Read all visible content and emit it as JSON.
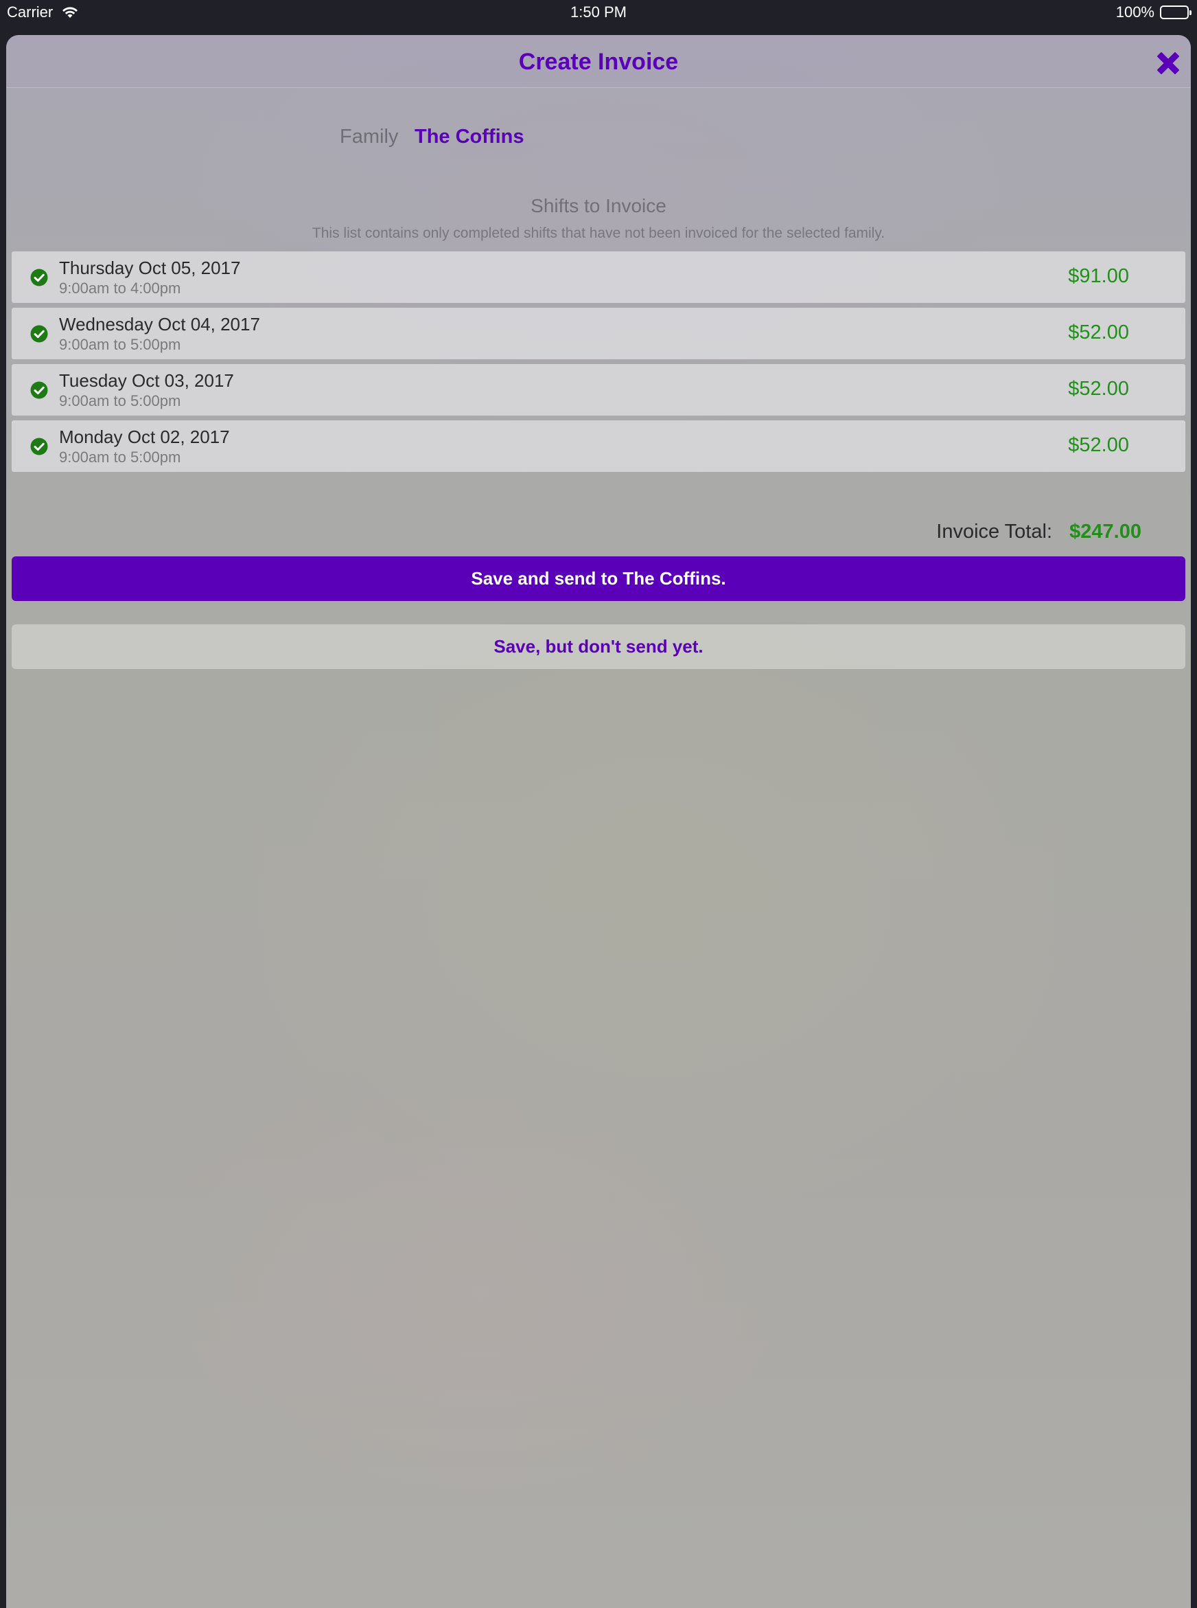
{
  "status_bar": {
    "carrier": "Carrier",
    "time": "1:50 PM",
    "battery": "100%"
  },
  "header": {
    "title": "Create Invoice",
    "close_icon": "close-x-icon"
  },
  "family": {
    "label": "Family",
    "value": "The Coffins"
  },
  "shifts_section": {
    "title": "Shifts to Invoice",
    "subtitle": "This list contains only completed shifts that have not been invoiced for the selected family."
  },
  "shifts": [
    {
      "day": "Thursday Oct 05, 2017",
      "hours": "9:00am to 4:00pm",
      "amount": "$91.00"
    },
    {
      "day": "Wednesday Oct 04, 2017",
      "hours": "9:00am to 5:00pm",
      "amount": "$52.00"
    },
    {
      "day": "Tuesday Oct 03, 2017",
      "hours": "9:00am to 5:00pm",
      "amount": "$52.00"
    },
    {
      "day": "Monday Oct 02, 2017",
      "hours": "9:00am to 5:00pm",
      "amount": "$52.00"
    }
  ],
  "total": {
    "label": "Invoice Total:",
    "value": "$247.00"
  },
  "actions": {
    "save_send": "Save and send to The Coffins.",
    "save_only": "Save, but don't send yet."
  },
  "colors": {
    "accent": "#5a00b8",
    "amount": "#218f1a",
    "check": "#1d7a14"
  }
}
